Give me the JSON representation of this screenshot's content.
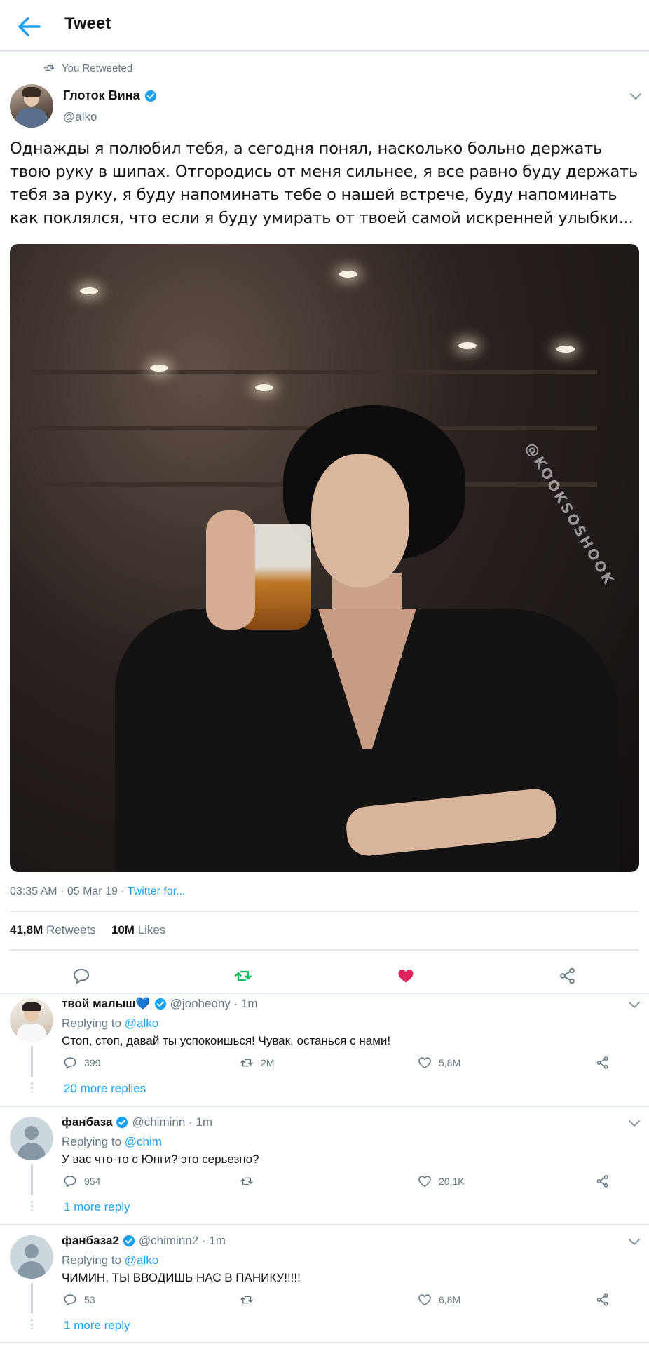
{
  "header": {
    "title": "Tweet",
    "back_icon": "arrow-left-icon"
  },
  "colors": {
    "accent": "#1da1f2",
    "retweet_green": "#17bf63",
    "like_red": "#e0245e",
    "muted": "#657786",
    "divider": "#e1e8ed"
  },
  "retweet_context": {
    "label": "You Retweeted",
    "icon": "retweet-icon"
  },
  "tweet": {
    "author_name": "Глоток Вина",
    "author_handle": "@alko",
    "text": "Однажды я полюбил тебя, а сегодня понял, насколько больно держать твою руку в шипах. Отгородись от меня сильнее, я все равно буду держать тебя за руку, я буду напоминать тебе о нашей встрече, буду напоминать как поклялся, что если я буду умирать от твоей самой искренней улыбки...",
    "media_watermark": "@KOOKSOSHOOK",
    "timestamp": "03:35 AM · 05 Mar 19 · ",
    "source": "Twitter for...",
    "retweets_count": "41,8M",
    "retweets_label": "Retweets",
    "likes_count": "10M",
    "likes_label": "Likes",
    "retweeted": true,
    "liked": true
  },
  "replies": [
    {
      "name": "твой малыш💙",
      "handle": "@jooheony · 1m",
      "replying_prefix": "Replying to ",
      "replying_to": "@alko",
      "text": "Стоп, стоп, давай ты успокоишься! Чувак, останься с нами!",
      "reply_count": "399",
      "retweet_count": "2M",
      "like_count": "5,8M",
      "more_label": "20 more replies"
    },
    {
      "name": "фанбаза",
      "handle": "@chiminn · 1m",
      "replying_prefix": "Replying to ",
      "replying_to": "@chim",
      "text": "У вас что-то с Юнги? это серьезно?",
      "reply_count": "954",
      "retweet_count": "",
      "like_count": "20,1K",
      "more_label": "1 more reply"
    },
    {
      "name": "фанбаза2",
      "handle": "@chiminn2 · 1m",
      "replying_prefix": "Replying to ",
      "replying_to": "@alko",
      "text": "ЧИМИН, ТЫ ВВОДИШЬ НАС В ПАНИКУ!!!!!",
      "reply_count": "53",
      "retweet_count": "",
      "like_count": "6,8M",
      "more_label": "1 more reply"
    }
  ]
}
